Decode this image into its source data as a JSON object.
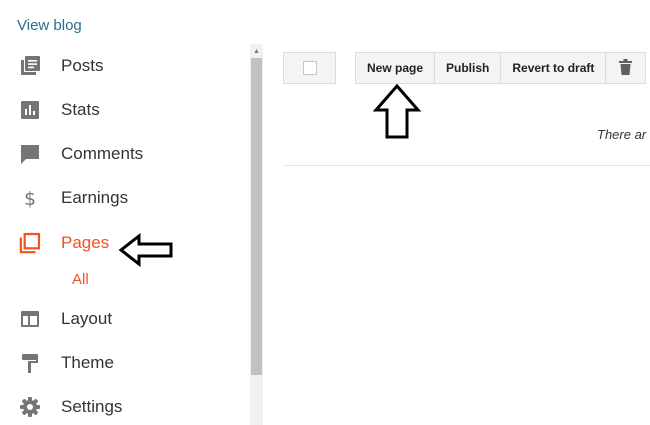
{
  "sidebar": {
    "view_blog": "View blog",
    "items": [
      {
        "label": "Posts",
        "icon": "posts-icon"
      },
      {
        "label": "Stats",
        "icon": "stats-icon"
      },
      {
        "label": "Comments",
        "icon": "comments-icon"
      },
      {
        "label": "Earnings",
        "icon": "dollar-icon"
      },
      {
        "label": "Pages",
        "icon": "pages-icon",
        "active": true
      },
      {
        "label": "Layout",
        "icon": "layout-icon"
      },
      {
        "label": "Theme",
        "icon": "paint-roller-icon"
      },
      {
        "label": "Settings",
        "icon": "gear-icon"
      }
    ],
    "pages_sub": {
      "label": "All"
    }
  },
  "toolbar": {
    "new_page": "New page",
    "publish": "Publish",
    "revert_to_draft": "Revert to draft",
    "delete_icon": "trash-icon"
  },
  "main": {
    "empty_text": "There ar"
  },
  "colors": {
    "accent": "#f4511e",
    "link": "#2a6f8f",
    "icon_gray": "#757575",
    "text": "#333333"
  }
}
